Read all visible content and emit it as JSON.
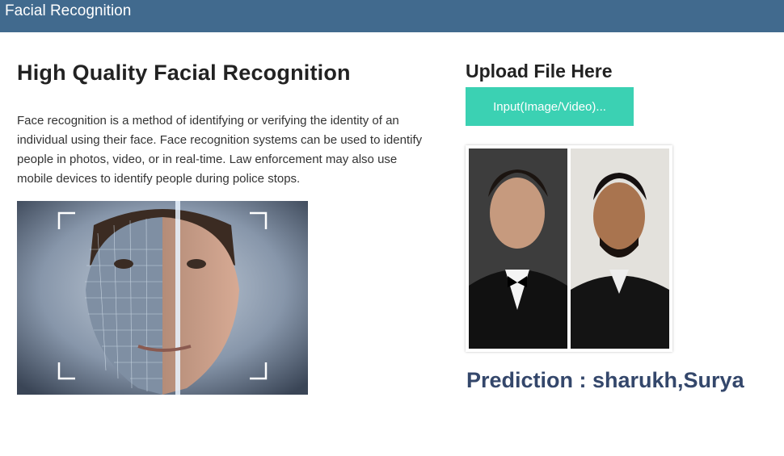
{
  "navbar": {
    "title": "Facial Recognition"
  },
  "main": {
    "heading": "High Quality Facial Recognition",
    "description": "Face recognition is a method of identifying or verifying the identity of an individual using their face. Face recognition systems can be used to identify people in photos, video, or in real-time. Law enforcement may also use mobile devices to identify people during police stops."
  },
  "upload": {
    "title": "Upload File Here",
    "button_label": "Input(Image/Video)..."
  },
  "prediction": {
    "text": "Prediction : sharukh,Surya"
  },
  "icons": {
    "face_scan_image": "face-scan-image",
    "uploaded_preview": "uploaded-photo-preview"
  },
  "colors": {
    "navbar": "#416a8e",
    "upload_button": "#3bd1b3",
    "prediction_text": "#34476b"
  }
}
